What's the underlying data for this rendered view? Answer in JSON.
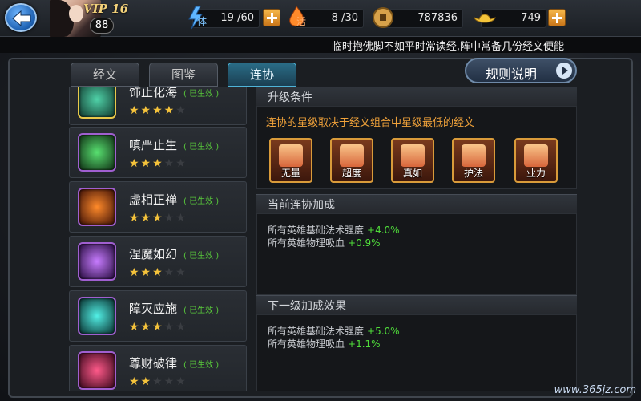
{
  "header": {
    "vip": "VIP 16",
    "level": "88",
    "stamina": {
      "icon": "lightning-icon",
      "char": "体",
      "value": "19 /60"
    },
    "vitality": {
      "icon": "flame-icon",
      "char": "活",
      "value": "8 /30"
    },
    "coins": {
      "icon": "coin-icon",
      "value": "787836"
    },
    "ingots": {
      "icon": "gold-ingot-icon",
      "value": "749"
    }
  },
  "tip": "临时抱佛脚不如平时常读经,阵中常备几份经文便能",
  "tabs": [
    {
      "label": "经文",
      "active": false
    },
    {
      "label": "图鉴",
      "active": false
    },
    {
      "label": "连协",
      "active": true
    }
  ],
  "rules_button": "规则说明",
  "list": [
    {
      "name": "饰止化海",
      "state": "( 已生效 )",
      "stars": 4,
      "color": "#e9d44a"
    },
    {
      "name": "嗔严止生",
      "state": "( 已生效 )",
      "stars": 3,
      "color": "#3ed25c"
    },
    {
      "name": "虚相正禅",
      "state": "( 已生效 )",
      "stars": 3,
      "color": "#e9641e"
    },
    {
      "name": "涅魔如幻",
      "state": "( 已生效 )",
      "stars": 3,
      "color": "#a44cf0"
    },
    {
      "name": "障灭应施",
      "state": "( 已生效 )",
      "stars": 3,
      "color": "#2fd7d0"
    },
    {
      "name": "尊财破律",
      "state": "( 已生效 )",
      "stars": 2,
      "color": "#e63c6e"
    }
  ],
  "upgrade": {
    "title": "升级条件",
    "desc": "连协的星级取决于经文组合中星级最低的经文",
    "cards": [
      "无量",
      "超度",
      "真如",
      "护法",
      "业力"
    ]
  },
  "current": {
    "title": "当前连协加成",
    "lines": [
      {
        "text": "所有英雄基础法术强度",
        "value": "+4.0%"
      },
      {
        "text": "所有英雄物理吸血",
        "value": "+0.9%"
      }
    ]
  },
  "next": {
    "title": "下一级加成效果",
    "lines": [
      {
        "text": "所有英雄基础法术强度",
        "value": "+5.0%"
      },
      {
        "text": "所有英雄物理吸血",
        "value": "+1.1%"
      }
    ]
  },
  "watermark": "www.365jz.com"
}
